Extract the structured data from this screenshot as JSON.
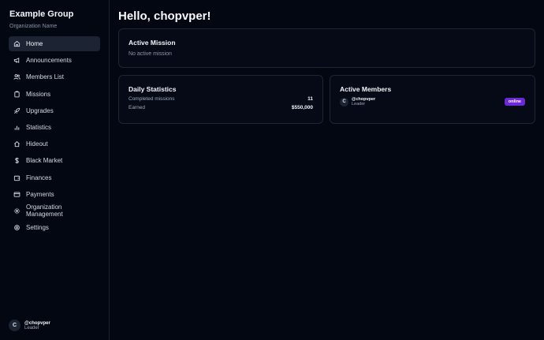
{
  "sidebar": {
    "org_title": "Example Group",
    "org_subtitle": "Organization Name",
    "items": [
      {
        "label": "Home",
        "icon": "home-icon",
        "active": true
      },
      {
        "label": "Announcements",
        "icon": "megaphone-icon"
      },
      {
        "label": "Members List",
        "icon": "users-icon"
      },
      {
        "label": "Missions",
        "icon": "clipboard-icon"
      },
      {
        "label": "Upgrades",
        "icon": "rocket-icon"
      },
      {
        "label": "Statistics",
        "icon": "bar-chart-icon"
      },
      {
        "label": "Hideout",
        "icon": "house-icon"
      },
      {
        "label": "Black Market",
        "icon": "dollar-icon"
      },
      {
        "label": "Finances",
        "icon": "wallet-icon"
      },
      {
        "label": "Payments",
        "icon": "credit-card-icon"
      },
      {
        "label": "Organization Management",
        "icon": "gear-icon"
      },
      {
        "label": "Settings",
        "icon": "settings-icon"
      }
    ],
    "user": {
      "initial": "C",
      "name": "@chopvper",
      "role": "Leader"
    }
  },
  "main": {
    "greeting": "Hello, chopvper!",
    "mission": {
      "title": "Active Mission",
      "text": "No active mission"
    },
    "stats": {
      "title": "Daily Statistics",
      "completed_label": "Completed missions",
      "completed_value": "11",
      "earned_label": "Earned",
      "earned_value": "$550,000"
    },
    "members": {
      "title": "Active Members",
      "list": [
        {
          "initial": "C",
          "name": "@chopvper",
          "role": "Leader",
          "status": "online"
        }
      ]
    }
  },
  "colors": {
    "background": "#030711",
    "active_item": "#1c2433",
    "online_badge": "#6d28d9"
  }
}
